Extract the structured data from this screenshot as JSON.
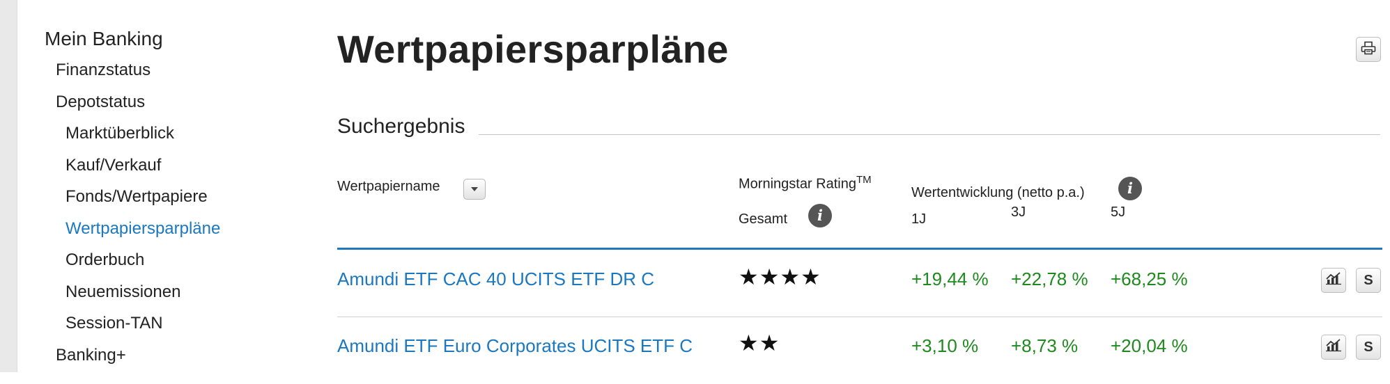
{
  "sidebar": {
    "title": "Mein Banking",
    "items": [
      {
        "label": "Finanzstatus",
        "level": 1,
        "active": false
      },
      {
        "label": "Depotstatus",
        "level": 1,
        "active": false
      },
      {
        "label": "Marktüberblick",
        "level": 2,
        "active": false
      },
      {
        "label": "Kauf/Verkauf",
        "level": 2,
        "active": false
      },
      {
        "label": "Fonds/Wertpapiere",
        "level": 2,
        "active": false
      },
      {
        "label": "Wertpapiersparpläne",
        "level": 2,
        "active": true
      },
      {
        "label": "Orderbuch",
        "level": 2,
        "active": false
      },
      {
        "label": "Neuemissionen",
        "level": 2,
        "active": false
      },
      {
        "label": "Session-TAN",
        "level": 2,
        "active": false
      },
      {
        "label": "Banking+",
        "level": 1,
        "active": false
      }
    ]
  },
  "page": {
    "title": "Wertpapiersparpläne",
    "print_icon": "printer-icon"
  },
  "results": {
    "section_title": "Suchergebnis",
    "headers": {
      "name": "Wertpapiername",
      "rating": "Morningstar Rating",
      "rating_sup": "TM",
      "rating_sub": "Gesamt",
      "perf": "Wertentwicklung (netto p.a.)",
      "y1": "1J",
      "y3": "3J",
      "y5": "5J"
    },
    "rows": [
      {
        "name": "Amundi ETF CAC 40 UCITS ETF DR C",
        "stars": "★★★★",
        "stars_value": 4,
        "y1": "+19,44 %",
        "y3": "+22,78 %",
        "y5": "+68,25 %",
        "s_label": "S"
      },
      {
        "name": "Amundi ETF Euro Corporates UCITS ETF C",
        "stars": "★★",
        "stars_value": 2,
        "y1": "+3,10 %",
        "y3": "+8,73 %",
        "y5": "+20,04 %",
        "s_label": "S"
      }
    ]
  },
  "colors": {
    "link": "#1a78c2",
    "positive": "#1e8a1e",
    "header_rule": "#1f77bd"
  }
}
